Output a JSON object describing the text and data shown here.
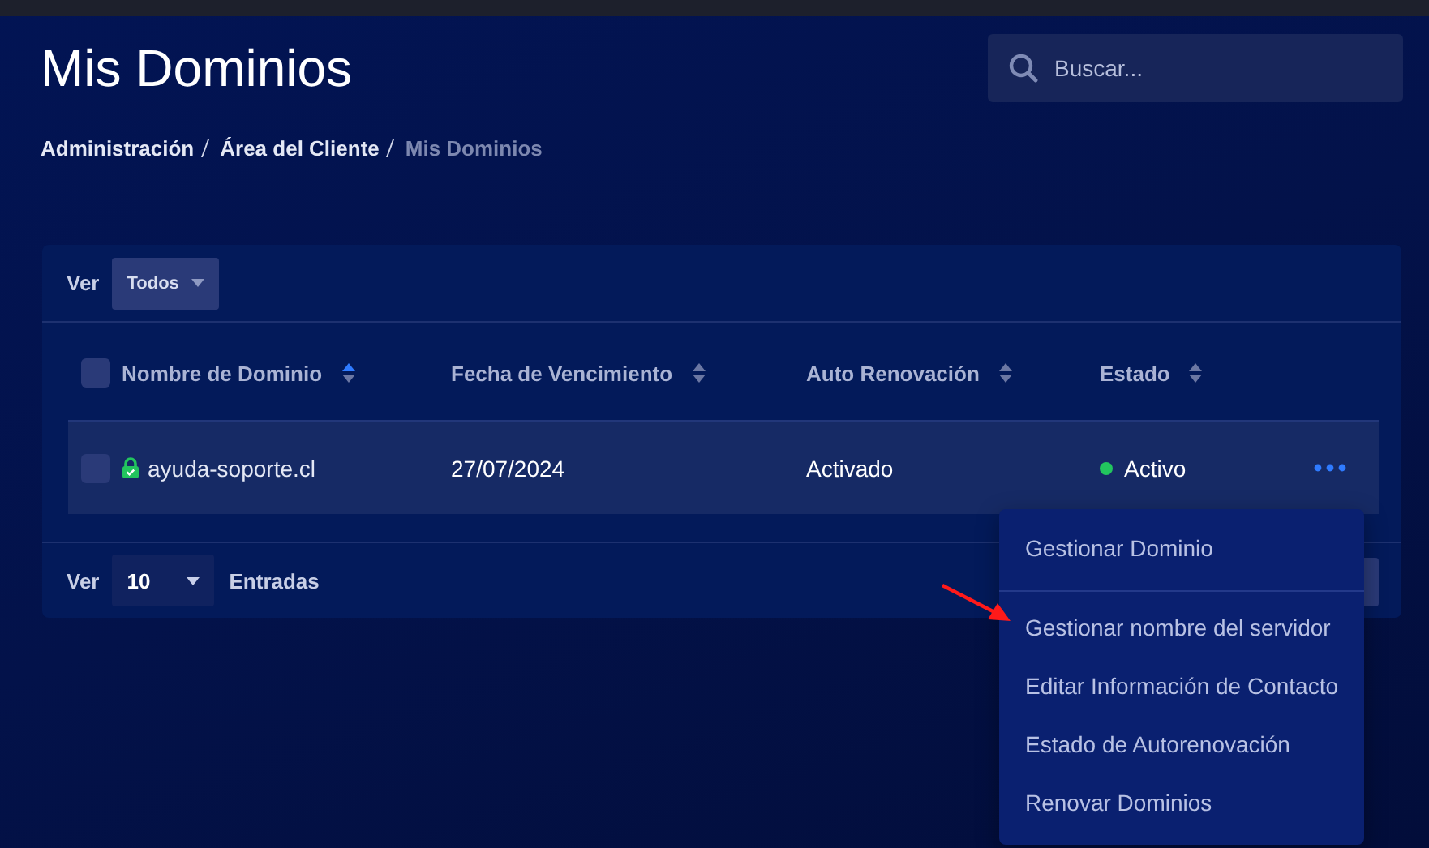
{
  "page": {
    "title": "Mis Dominios",
    "breadcrumb": [
      {
        "label": "Administración",
        "current": false
      },
      {
        "label": "Área del Cliente",
        "current": false
      },
      {
        "label": "Mis Dominios",
        "current": true
      }
    ]
  },
  "search": {
    "placeholder": "Buscar..."
  },
  "filter": {
    "label": "Ver",
    "value": "Todos"
  },
  "table": {
    "columns": [
      {
        "label": "Nombre de Dominio",
        "sorted": true
      },
      {
        "label": "Fecha de Vencimiento",
        "sorted": false
      },
      {
        "label": "Auto Renovación",
        "sorted": false
      },
      {
        "label": "Estado",
        "sorted": false
      }
    ],
    "select_all_checked": false,
    "rows": [
      {
        "checked": false,
        "secure": true,
        "domain": "ayuda-soporte.cl",
        "expiry": "27/07/2024",
        "auto_renew": "Activado",
        "status": "Activo",
        "color": "#22c55e"
      }
    ]
  },
  "footer": {
    "label": "Ver",
    "page_size": "10",
    "suffix": "Entradas"
  },
  "menu": {
    "items": [
      {
        "label": "Gestionar Dominio",
        "divider_after": true
      },
      {
        "label": "Gestionar nombre del servidor",
        "divider_after": false
      },
      {
        "label": "Editar Información de Contacto",
        "divider_after": false
      },
      {
        "label": "Estado de Autorenovación",
        "divider_after": false
      },
      {
        "label": "Renovar Dominios",
        "divider_after": false
      }
    ]
  }
}
